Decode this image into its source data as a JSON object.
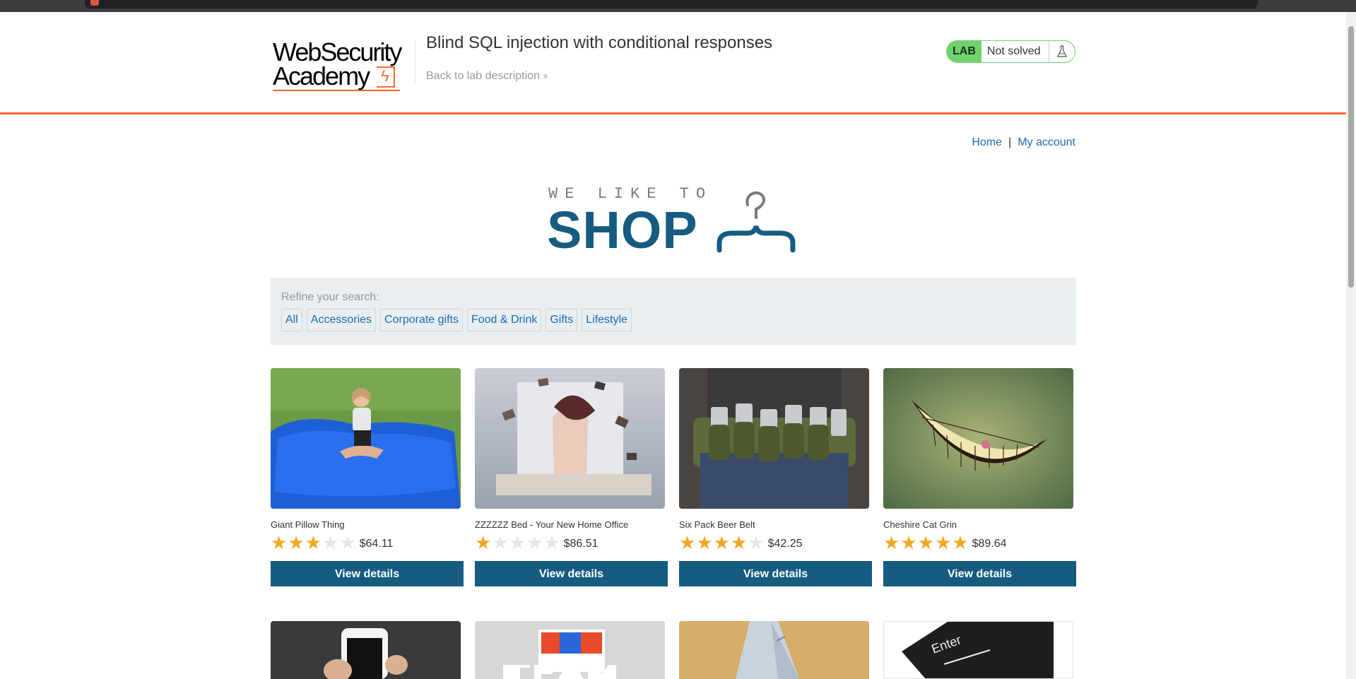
{
  "lab": {
    "logo_line1": "WebSecurity",
    "logo_line2": "Academy",
    "title": "Blind SQL injection with conditional responses",
    "back_link": "Back to lab description",
    "status_tag": "LAB",
    "status_text": "Not solved",
    "icon": "flask-icon"
  },
  "nav": {
    "home": "Home",
    "separator": "|",
    "account": "My account"
  },
  "shop_logo": {
    "line1": "WE LIKE TO",
    "line2": "SHOP",
    "icon": "hanger-icon"
  },
  "filter": {
    "label": "Refine your search:",
    "categories": [
      "All",
      "Accessories",
      "Corporate gifts",
      "Food & Drink",
      "Gifts",
      "Lifestyle"
    ]
  },
  "products": [
    {
      "name": "Giant Pillow Thing",
      "rating": 3,
      "price": "$64.11",
      "button": "View details"
    },
    {
      "name": "ZZZZZZ Bed - Your New Home Office",
      "rating": 1,
      "price": "$86.51",
      "button": "View details"
    },
    {
      "name": "Six Pack Beer Belt",
      "rating": 4,
      "price": "$42.25",
      "button": "View details"
    },
    {
      "name": "Cheshire Cat Grin",
      "rating": 5,
      "price": "$89.64",
      "button": "View details"
    }
  ],
  "colors": {
    "accent": "#ff6633",
    "primary": "#155c80",
    "link": "#1c6bb4",
    "star": "#f5a623",
    "lab_green": "#70d16d"
  }
}
